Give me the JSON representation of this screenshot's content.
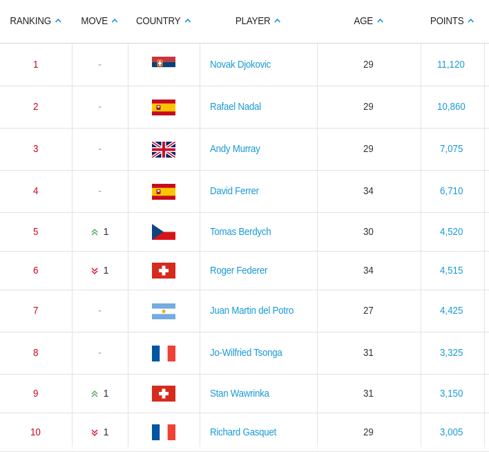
{
  "header": {
    "ranking": "RANKING",
    "move": "MOVE",
    "country": "COUNTRY",
    "player": "PLAYER",
    "age": "AGE",
    "points": "POINTS"
  },
  "colors": {
    "rank": "#d0021b",
    "link": "#1a9ad6",
    "up": "#3fa34d",
    "down": "#d0021b",
    "caret": "#1a9ad6"
  },
  "rows": [
    {
      "rank": "1",
      "move": "-",
      "move_dir": "none",
      "country": "serbia-flag",
      "player": "Novak Djokovic",
      "age": "29",
      "points": "11,120"
    },
    {
      "rank": "2",
      "move": "-",
      "move_dir": "none",
      "country": "spain-flag",
      "player": "Rafael Nadal",
      "age": "29",
      "points": "10,860"
    },
    {
      "rank": "3",
      "move": "-",
      "move_dir": "none",
      "country": "uk-flag",
      "player": "Andy Murray",
      "age": "29",
      "points": "7,075"
    },
    {
      "rank": "4",
      "move": "-",
      "move_dir": "none",
      "country": "spain-flag",
      "player": "David Ferrer",
      "age": "34",
      "points": "6,710"
    },
    {
      "rank": "5",
      "move": "1",
      "move_dir": "up",
      "country": "czech-flag",
      "player": "Tomas Berdych",
      "age": "30",
      "points": "4,520"
    },
    {
      "rank": "6",
      "move": "1",
      "move_dir": "down",
      "country": "switzerland-flag",
      "player": "Roger Federer",
      "age": "34",
      "points": "4,515"
    },
    {
      "rank": "7",
      "move": "-",
      "move_dir": "none",
      "country": "argentina-flag",
      "player": "Juan Martin del Potro",
      "age": "27",
      "points": "4,425"
    },
    {
      "rank": "8",
      "move": "-",
      "move_dir": "none",
      "country": "france-flag",
      "player": "Jo-Wilfried Tsonga",
      "age": "31",
      "points": "3,325"
    },
    {
      "rank": "9",
      "move": "1",
      "move_dir": "up",
      "country": "switzerland-flag",
      "player": "Stan Wawrinka",
      "age": "31",
      "points": "3,150"
    },
    {
      "rank": "10",
      "move": "1",
      "move_dir": "down",
      "country": "france-flag",
      "player": "Richard Gasquet",
      "age": "29",
      "points": "3,005"
    }
  ]
}
